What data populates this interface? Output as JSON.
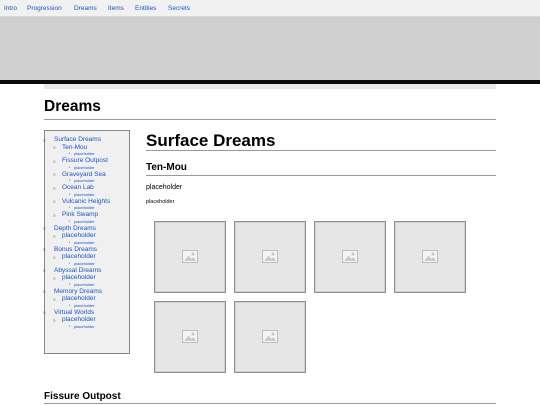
{
  "nav": {
    "items": [
      "Intro",
      "Progression",
      "Dreams",
      "Items",
      "Entities",
      "Secrets"
    ]
  },
  "page": {
    "title": "Dreams"
  },
  "toc": {
    "items": [
      {
        "level": 1,
        "label": "Surface Dreams"
      },
      {
        "level": 2,
        "label": "Ten-Mou"
      },
      {
        "level": 3,
        "label": "placeholder"
      },
      {
        "level": 2,
        "label": "Fissure Outpost"
      },
      {
        "level": 3,
        "label": "placeholder"
      },
      {
        "level": 2,
        "label": "Graveyard Sea"
      },
      {
        "level": 3,
        "label": "placeholder"
      },
      {
        "level": 2,
        "label": "Ocean Lab"
      },
      {
        "level": 3,
        "label": "placeholder"
      },
      {
        "level": 2,
        "label": "Vulcanic Heights"
      },
      {
        "level": 3,
        "label": "placeholder"
      },
      {
        "level": 2,
        "label": "Pink Swamp"
      },
      {
        "level": 3,
        "label": "placeholder"
      },
      {
        "level": 1,
        "label": "Depth Dreams"
      },
      {
        "level": 2,
        "label": "placeholder"
      },
      {
        "level": 3,
        "label": "placeholder"
      },
      {
        "level": 1,
        "label": "Bonus Dreams"
      },
      {
        "level": 2,
        "label": "placeholder"
      },
      {
        "level": 3,
        "label": "placeholder"
      },
      {
        "level": 1,
        "label": "Abyssal Dreams"
      },
      {
        "level": 2,
        "label": "placeholder"
      },
      {
        "level": 3,
        "label": "placeholder"
      },
      {
        "level": 1,
        "label": "Memory Dreams"
      },
      {
        "level": 2,
        "label": "placeholder"
      },
      {
        "level": 3,
        "label": "placeholder"
      },
      {
        "level": 1,
        "label": "Virtual Worlds"
      },
      {
        "level": 2,
        "label": "placeholder"
      },
      {
        "level": 3,
        "label": "placeholder"
      }
    ]
  },
  "section": {
    "title": "Surface Dreams",
    "subsection_title": "Ten-Mou",
    "paragraph_1": "placeholder",
    "paragraph_2": "placeholder",
    "gallery": [
      {
        "icon": "image-placeholder-icon"
      },
      {
        "icon": "image-placeholder-icon"
      },
      {
        "icon": "image-placeholder-icon"
      },
      {
        "icon": "image-placeholder-icon"
      },
      {
        "icon": "image-placeholder-icon"
      },
      {
        "icon": "image-placeholder-icon"
      }
    ]
  },
  "next_section": {
    "title": "Fissure Outpost"
  },
  "colors": {
    "link": "#1a55c4",
    "banner": "#cfcfcf",
    "banner_border": "#0b0b0b",
    "toc_background": "#f0f0f0"
  }
}
